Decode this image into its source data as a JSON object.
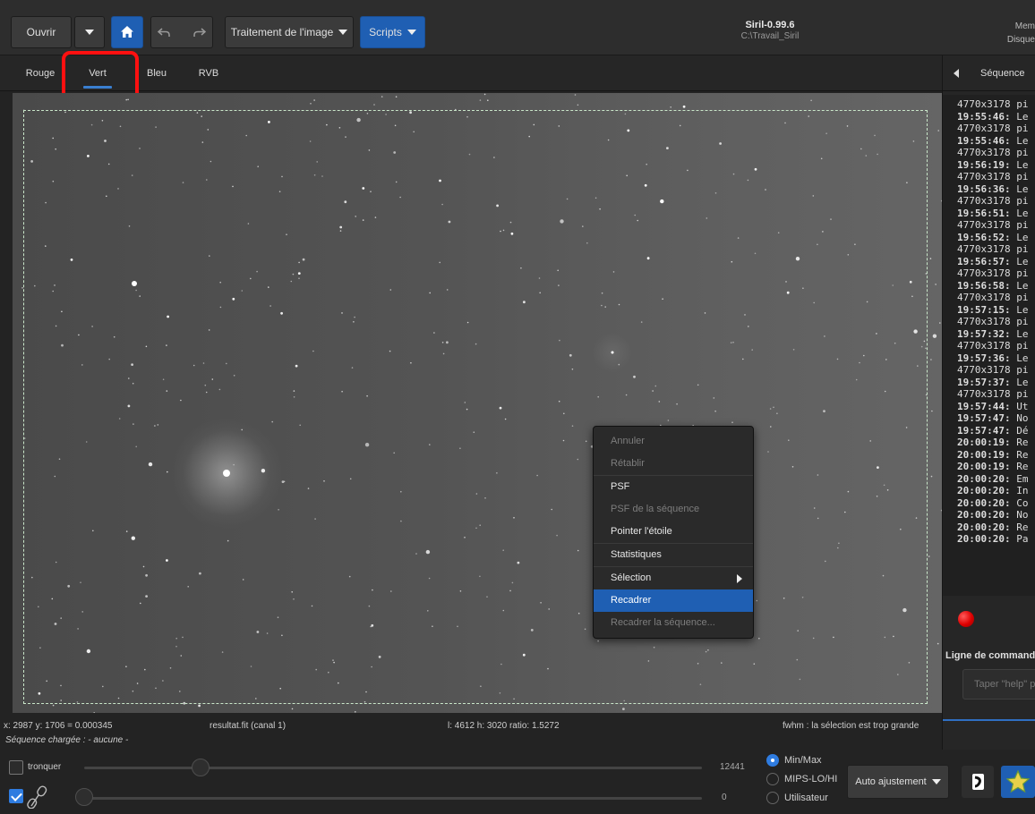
{
  "header": {
    "open_label": "Ouvrir",
    "image_processing_label": "Traitement de l'image",
    "scripts_label": "Scripts",
    "app_title": "Siril-0.99.6",
    "working_dir": "C:\\Travail_Siril",
    "memory_label": "Mem",
    "disk_label": "Disque"
  },
  "tabs": [
    {
      "label": "Rouge"
    },
    {
      "label": "Vert",
      "active": true
    },
    {
      "label": "Bleu"
    },
    {
      "label": "RVB"
    }
  ],
  "context_menu": {
    "items": [
      {
        "label": "Annuler",
        "enabled": false
      },
      {
        "label": "Rétablir",
        "enabled": false
      },
      {
        "label": "PSF",
        "enabled": true
      },
      {
        "label": "PSF de la séquence",
        "enabled": false
      },
      {
        "label": "Pointer l'étoile",
        "enabled": true
      },
      {
        "label": "Statistiques",
        "enabled": true
      },
      {
        "label": "Sélection",
        "enabled": true,
        "submenu": true
      },
      {
        "label": "Recadrer",
        "enabled": true,
        "highlighted": true
      },
      {
        "label": "Recadrer la séquence...",
        "enabled": false
      }
    ]
  },
  "status": {
    "cursor": "x: 2987 y: 1706 = 0.000345",
    "filename": "resultat.fit (canal 1)",
    "selection_info": "l: 4612 h: 3020 ratio: 1.5272",
    "fwhm": "fwhm : la sélection est trop grande",
    "sequence": "Séquence chargée : - aucune -"
  },
  "controls": {
    "clip_label": "tronquer",
    "clip_checked": false,
    "link_checked": true,
    "high_value": "12441",
    "low_value": "0",
    "scale_options": [
      {
        "label": "Min/Max",
        "selected": true
      },
      {
        "label": "MIPS-LO/HI",
        "selected": false
      },
      {
        "label": "Utilisateur",
        "selected": false
      }
    ],
    "auto_adjust_label": "Auto ajustement"
  },
  "right_panel": {
    "tab_label": "Séquence",
    "log_lines": [
      {
        "time": "",
        "text": "4770x3178 pi"
      },
      {
        "time": "19:55:46:",
        "text": "Le"
      },
      {
        "time": "",
        "text": "4770x3178 pi"
      },
      {
        "time": "19:55:46:",
        "text": "Le"
      },
      {
        "time": "",
        "text": "4770x3178 pi"
      },
      {
        "time": "19:56:19:",
        "text": "Le"
      },
      {
        "time": "",
        "text": "4770x3178 pi"
      },
      {
        "time": "19:56:36:",
        "text": "Le"
      },
      {
        "time": "",
        "text": "4770x3178 pi"
      },
      {
        "time": "19:56:51:",
        "text": "Le"
      },
      {
        "time": "",
        "text": "4770x3178 pi"
      },
      {
        "time": "19:56:52:",
        "text": "Le"
      },
      {
        "time": "",
        "text": "4770x3178 pi"
      },
      {
        "time": "19:56:57:",
        "text": "Le"
      },
      {
        "time": "",
        "text": "4770x3178 pi"
      },
      {
        "time": "19:56:58:",
        "text": "Le"
      },
      {
        "time": "",
        "text": "4770x3178 pi"
      },
      {
        "time": "19:57:15:",
        "text": "Le"
      },
      {
        "time": "",
        "text": "4770x3178 pi"
      },
      {
        "time": "19:57:32:",
        "text": "Le"
      },
      {
        "time": "",
        "text": "4770x3178 pi"
      },
      {
        "time": "19:57:36:",
        "text": "Le"
      },
      {
        "time": "",
        "text": "4770x3178 pi"
      },
      {
        "time": "19:57:37:",
        "text": "Le"
      },
      {
        "time": "",
        "text": "4770x3178 pi"
      },
      {
        "time": "19:57:44:",
        "text": "Ut"
      },
      {
        "time": "19:57:47:",
        "text": "No"
      },
      {
        "time": "19:57:47:",
        "text": "Dé"
      },
      {
        "time": "20:00:19:",
        "text": "Re"
      },
      {
        "time": "20:00:19:",
        "text": "Re"
      },
      {
        "time": "20:00:19:",
        "text": "Re"
      },
      {
        "time": "20:00:20:",
        "text": "Em"
      },
      {
        "time": "20:00:20:",
        "text": "In"
      },
      {
        "time": "20:00:20:",
        "text": "Co"
      },
      {
        "time": "20:00:20:",
        "text": "No"
      },
      {
        "time": "20:00:20:",
        "text": "Re"
      },
      {
        "time": "20:00:20:",
        "text": "Pa"
      }
    ],
    "command_label": "Ligne de commande",
    "command_placeholder": "Taper \"help\" po"
  },
  "colors": {
    "accent": "#1f5fb3",
    "highlight_annotation": "#ff1010",
    "selection_rect": "#c9e6c9"
  }
}
